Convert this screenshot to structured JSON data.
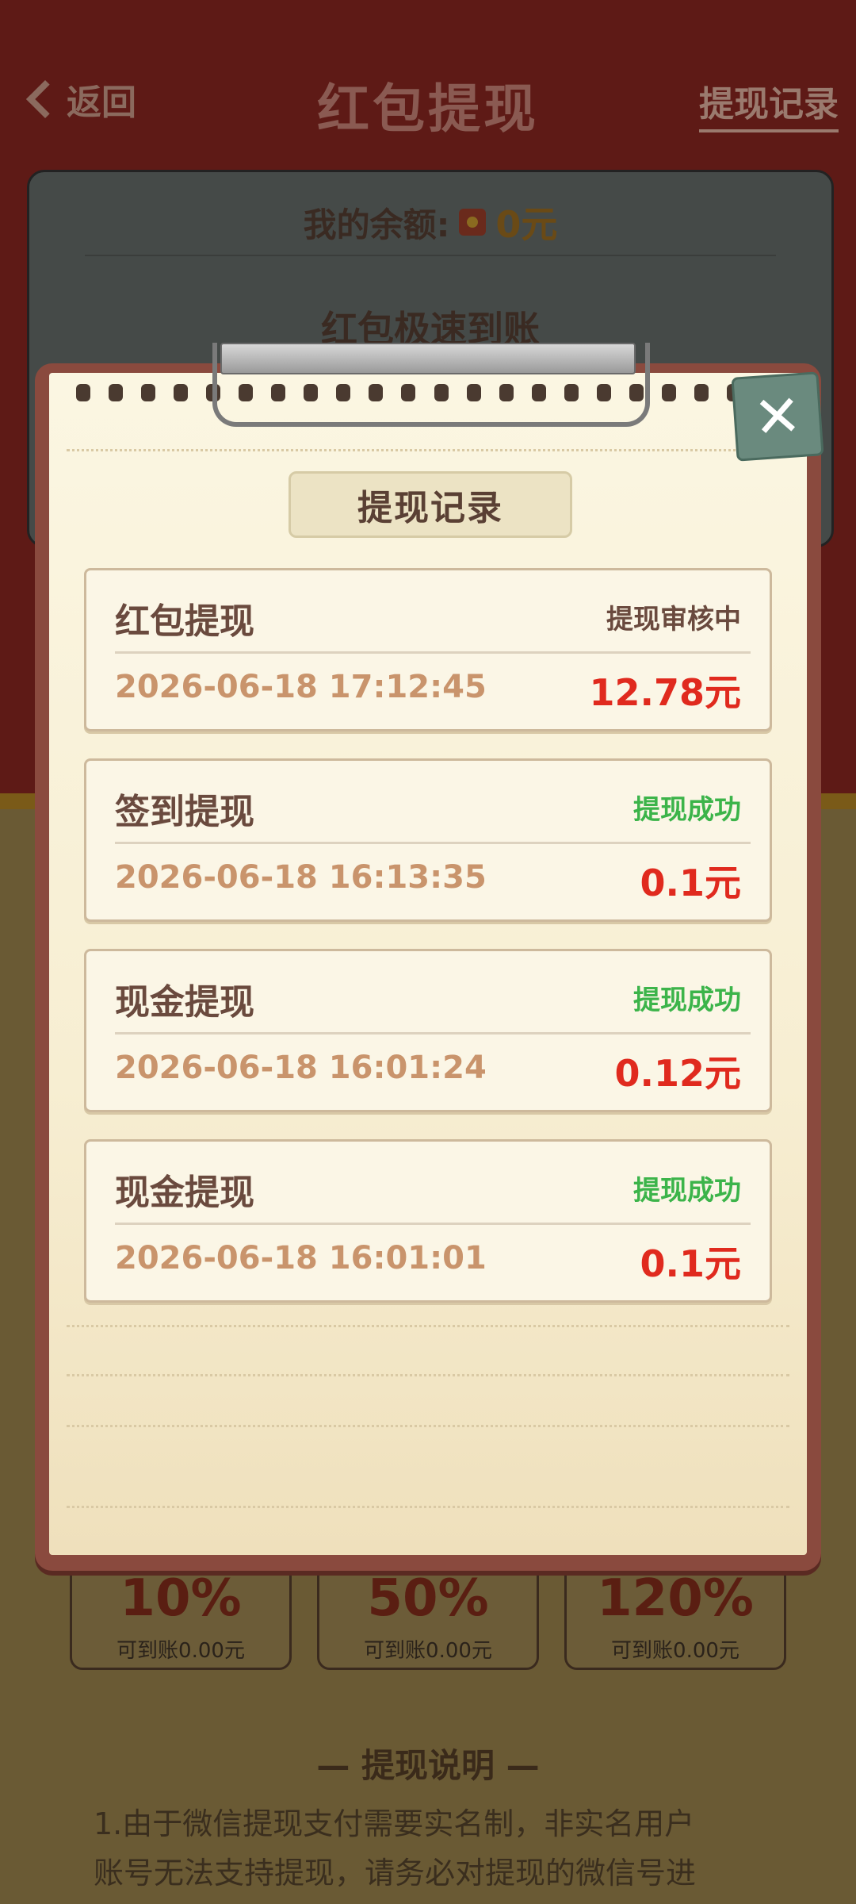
{
  "header": {
    "back_label": "返回",
    "title": "红包提现",
    "records_link": "提现记录"
  },
  "balance": {
    "label": "我的余额:",
    "amount": "0元"
  },
  "fast": {
    "title": "红包极速到账"
  },
  "percent_options": [
    {
      "pct": "10%",
      "sub": "可到账0.00元"
    },
    {
      "pct": "50%",
      "sub": "可到账0.00元"
    },
    {
      "pct": "120%",
      "sub": "可到账0.00元"
    }
  ],
  "notes": {
    "title": "— 提现说明 —",
    "line1": "1.由于微信提现支付需要实名制，非实名用户",
    "line2": "账号无法支持提现，请务必对提现的微信号进"
  },
  "modal": {
    "title": "提现记录",
    "close_glyph": "✕",
    "records": [
      {
        "title": "红包提现",
        "status": "提现审核中",
        "status_color": "#6a4a3e",
        "time": "2026-06-18 17:12:45",
        "amount": "12.78元"
      },
      {
        "title": "签到提现",
        "status": "提现成功",
        "status_color": "#3cb44a",
        "time": "2026-06-18 16:13:35",
        "amount": "0.1元"
      },
      {
        "title": "现金提现",
        "status": "提现成功",
        "status_color": "#3cb44a",
        "time": "2026-06-18 16:01:24",
        "amount": "0.12元"
      },
      {
        "title": "现金提现",
        "status": "提现成功",
        "status_color": "#3cb44a",
        "time": "2026-06-18 16:01:01",
        "amount": "0.1元"
      }
    ]
  }
}
